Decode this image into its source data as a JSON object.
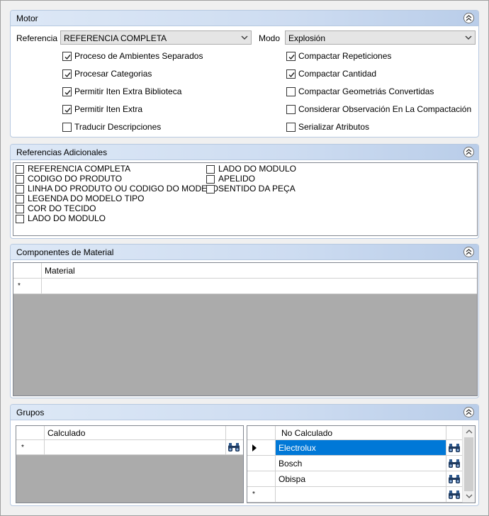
{
  "motor": {
    "title": "Motor",
    "referencia_label": "Referencia",
    "referencia_value": "REFERENCIA COMPLETA",
    "modo_label": "Modo",
    "modo_value": "Explosión",
    "left_checks": [
      {
        "label": "Proceso de Ambientes Separados",
        "checked": true
      },
      {
        "label": "Procesar Categorias",
        "checked": true
      },
      {
        "label": "Permitir Iten Extra Biblioteca",
        "checked": true
      },
      {
        "label": "Permitir Iten Extra",
        "checked": true
      },
      {
        "label": "Traducir Descripciones",
        "checked": false
      }
    ],
    "right_checks": [
      {
        "label": "Compactar Repeticiones",
        "checked": true
      },
      {
        "label": "Compactar Cantidad",
        "checked": true
      },
      {
        "label": "Compactar Geometriás Convertidas",
        "checked": false
      },
      {
        "label": "Considerar Observación En La Compactación",
        "checked": false
      },
      {
        "label": "Serializar Atributos",
        "checked": false
      }
    ]
  },
  "referencias": {
    "title": "Referencias Adicionales",
    "col1": [
      "REFERENCIA COMPLETA",
      "CODIGO DO PRODUTO",
      "LINHA DO PRODUTO OU CODIGO DO MODELO",
      "LEGENDA DO MODELO TIPO",
      "COR DO TECIDO",
      "LADO DO MODULO"
    ],
    "col2": [
      "LADO DO MODULO",
      "APELIDO",
      "SENTIDO DA PEÇA"
    ]
  },
  "componentes": {
    "title": "Componentes de Material",
    "column": "Material",
    "new_row_marker": "*"
  },
  "grupos": {
    "title": "Grupos",
    "calculado_column": "Calculado",
    "no_calculado_column": "No Calculado",
    "new_row_marker": "*",
    "no_calculado_rows": [
      "Electrolux",
      "Bosch",
      "Obispa"
    ]
  },
  "icons": {
    "collapse": "double-chevron-up-icon",
    "dropdown": "chevron-down-icon",
    "search": "binoculars-icon",
    "current_row": "triangle-right-icon"
  },
  "colors": {
    "header_start": "#dde8f6",
    "header_end": "#b9cde9",
    "selection": "#0078d7",
    "grid_empty": "#ababab"
  }
}
